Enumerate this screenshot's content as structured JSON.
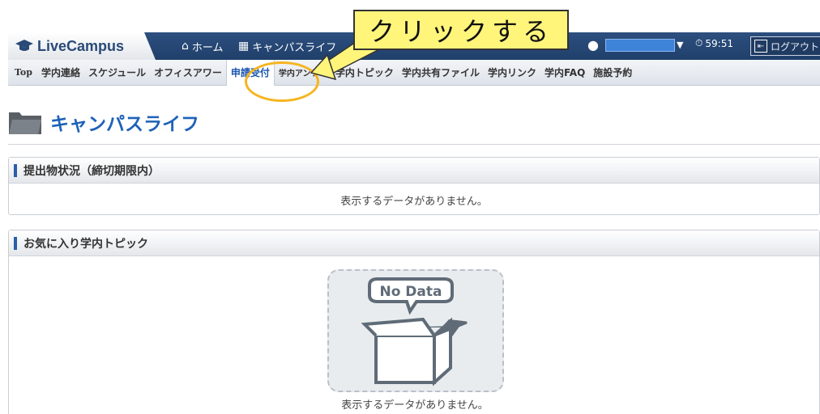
{
  "header": {
    "logo": "LiveCampus",
    "nav": [
      {
        "label": "ホーム",
        "icon": "home-icon"
      },
      {
        "label": "キャンパスライフ",
        "icon": "campus-icon"
      }
    ],
    "timer": "59:51",
    "logout_label": "ログアウト"
  },
  "subnav": {
    "items": [
      {
        "label": "Top"
      },
      {
        "label": "学内連絡"
      },
      {
        "label": "スケジュール"
      },
      {
        "label": "オフィスアワー"
      },
      {
        "label": "申請受付",
        "active": true
      },
      {
        "label": "学内アンケート"
      },
      {
        "label": "学内トピック"
      },
      {
        "label": "学内共有ファイル"
      },
      {
        "label": "学内リンク"
      },
      {
        "label": "学内FAQ"
      },
      {
        "label": "施設予約"
      }
    ]
  },
  "callout": {
    "text": "クリックする"
  },
  "page": {
    "title": "キャンパスライフ"
  },
  "panels": [
    {
      "title": "提出物状況（締切期限内）",
      "empty_text": "表示するデータがありません。"
    },
    {
      "title": "お気に入り学内トピック",
      "empty_text": "表示するデータがありません。",
      "badge": "No Data"
    }
  ],
  "colors": {
    "header_bg": "#20406b",
    "accent": "#1e62b8",
    "callout_bg": "#fff57a",
    "highlight_ring": "#f5b520"
  }
}
